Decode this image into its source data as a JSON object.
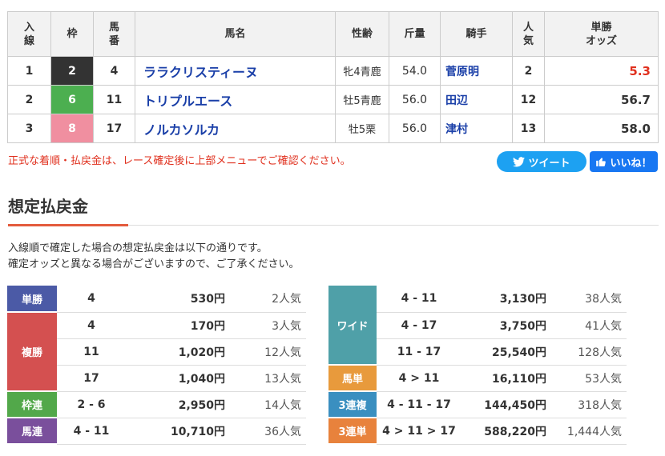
{
  "result": {
    "headers": {
      "rank": "入\n線",
      "waku": "枠",
      "num": "馬\n番",
      "horse": "馬名",
      "sex": "性齢",
      "weight": "斤量",
      "jockey": "騎手",
      "pop": "人\n気",
      "odds": "単勝\nオッズ"
    },
    "rows": [
      {
        "rank": "1",
        "waku": "2",
        "waku_bg": "#333333",
        "waku_fg": "#ffffff",
        "num": "4",
        "horse": "ララクリスティーヌ",
        "sex": "牝4青鹿",
        "weight": "54.0",
        "jockey": "菅原明",
        "pop": "2",
        "odds": "5.3",
        "odds_color": "#e0301e"
      },
      {
        "rank": "2",
        "waku": "6",
        "waku_bg": "#4caf50",
        "waku_fg": "#ffffff",
        "num": "11",
        "horse": "トリプルエース",
        "sex": "牡5青鹿",
        "weight": "56.0",
        "jockey": "田辺",
        "pop": "12",
        "odds": "56.7",
        "odds_color": "#333333"
      },
      {
        "rank": "3",
        "waku": "8",
        "waku_bg": "#f08fa0",
        "waku_fg": "#ffffff",
        "num": "17",
        "horse": "ノルカソルカ",
        "sex": "牡5栗",
        "weight": "56.0",
        "jockey": "津村",
        "pop": "13",
        "odds": "58.0",
        "odds_color": "#333333"
      }
    ]
  },
  "notice": "正式な着順・払戻金は、レース確定後に上部メニューでご確認ください。",
  "share": {
    "tweet_label": "ツイート",
    "like_label": "いいね！",
    "tweet_icon": "twitter-bird-icon",
    "like_icon": "thumbs-up-icon"
  },
  "section": {
    "title": "想定払戻金",
    "desc_line1": "入線順で確定した場合の想定払戻金は以下の通りです。",
    "desc_line2": "確定オッズと異なる場合がございますので、ご了承ください。"
  },
  "payouts_left": [
    {
      "key": "tansho",
      "label": "単勝",
      "color": "#4b5aa6",
      "entries": [
        {
          "combo": "4",
          "yen": "530円",
          "pop": "2人気"
        }
      ]
    },
    {
      "key": "fukusho",
      "label": "複勝",
      "color": "#d45050",
      "entries": [
        {
          "combo": "4",
          "yen": "170円",
          "pop": "3人気"
        },
        {
          "combo": "11",
          "yen": "1,020円",
          "pop": "12人気"
        },
        {
          "combo": "17",
          "yen": "1,040円",
          "pop": "13人気"
        }
      ]
    },
    {
      "key": "wakuren",
      "label": "枠連",
      "color": "#52a84a",
      "entries": [
        {
          "combo": "2 - 6",
          "yen": "2,950円",
          "pop": "14人気"
        }
      ]
    },
    {
      "key": "umaren",
      "label": "馬連",
      "color": "#7a4f9c",
      "entries": [
        {
          "combo": "4 - 11",
          "yen": "10,710円",
          "pop": "36人気"
        }
      ]
    }
  ],
  "payouts_right": [
    {
      "key": "wide",
      "label": "ワイド",
      "color": "#4fa0a8",
      "entries": [
        {
          "combo": "4 - 11",
          "yen": "3,130円",
          "pop": "38人気"
        },
        {
          "combo": "4 - 17",
          "yen": "3,750円",
          "pop": "41人気"
        },
        {
          "combo": "11 - 17",
          "yen": "25,540円",
          "pop": "128人気"
        }
      ]
    },
    {
      "key": "umatan",
      "label": "馬単",
      "color": "#e89a3c",
      "entries": [
        {
          "combo": "4 > 11",
          "yen": "16,110円",
          "pop": "53人気"
        }
      ]
    },
    {
      "key": "sanrenpuku",
      "label": "3連複",
      "color": "#3a8fc0",
      "entries": [
        {
          "combo": "4 - 11 - 17",
          "yen": "144,450円",
          "pop": "318人気"
        }
      ]
    },
    {
      "key": "sanrentan",
      "label": "3連単",
      "color": "#e8823c",
      "entries": [
        {
          "combo": "4 > 11 > 17",
          "yen": "588,220円",
          "pop": "1,444人気"
        }
      ]
    }
  ]
}
